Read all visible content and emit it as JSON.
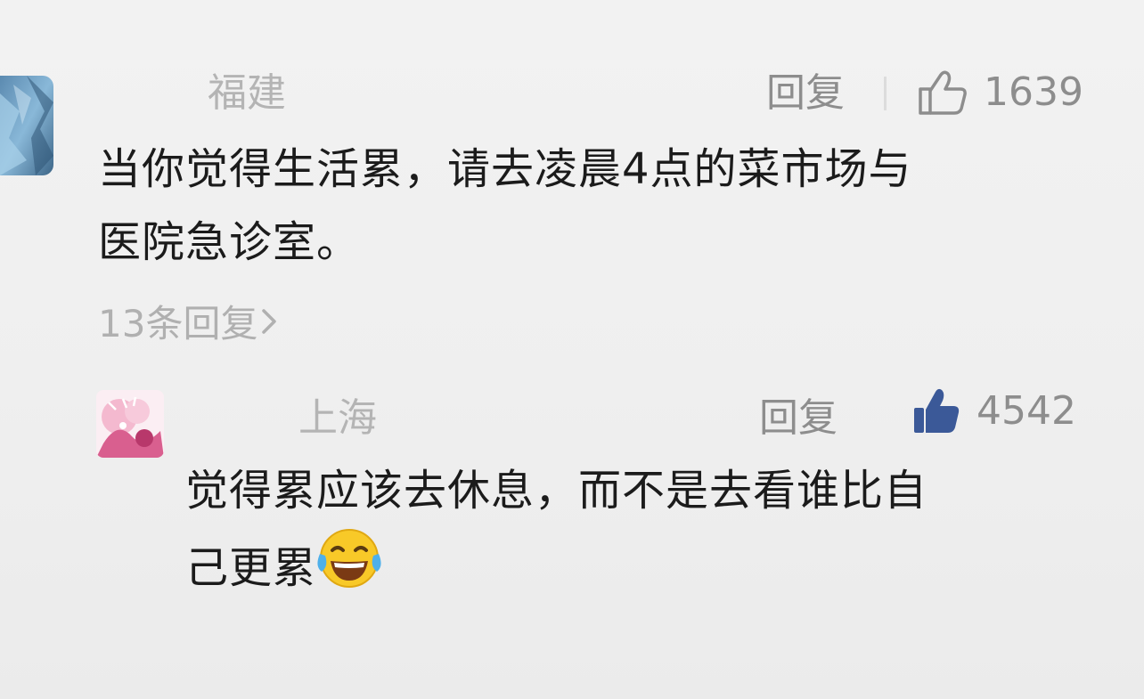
{
  "comments": [
    {
      "location": "福建",
      "reply_label": "回复",
      "like_count": "1639",
      "liked": false,
      "text_lines": [
        "当你觉得生活累，请去凌晨4点的菜市场与",
        "医院急诊室。"
      ],
      "replies_link": "13条回复",
      "avatar_icon": "blue-landscape-avatar"
    },
    {
      "location": "上海",
      "reply_label": "回复",
      "like_count": "4542",
      "liked": true,
      "text_lines": [
        "觉得累应该去休息，而不是去看谁比自",
        "己更累"
      ],
      "emoji_icon": "laughing-tears-emoji",
      "avatar_icon": "pink-anime-avatar"
    }
  ],
  "colors": {
    "liked_thumb": "#3b5998",
    "unliked_thumb": "#8d8d8d",
    "meta_text": "#8d8d8d",
    "location_text": "#b4b4b4"
  }
}
